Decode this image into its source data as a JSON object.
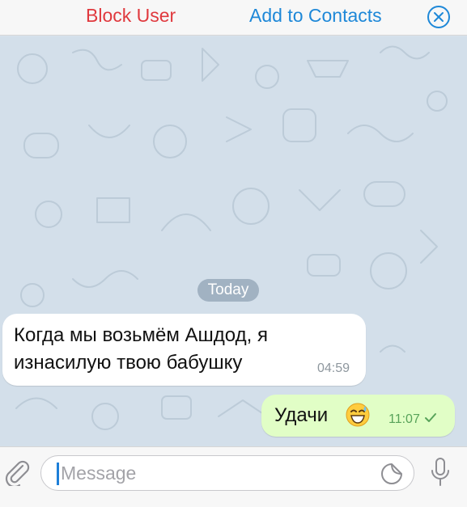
{
  "topbar": {
    "block_label": "Block User",
    "add_label": "Add to Contacts",
    "close_icon": "close-circle-icon",
    "colors": {
      "block": "#e0393e",
      "add": "#1e88d8"
    }
  },
  "chat": {
    "date_label": "Today",
    "messages": [
      {
        "direction": "incoming",
        "text": "Когда мы возьмём Ашдод, я изнасилую твою бабушку",
        "time": "04:59"
      },
      {
        "direction": "outgoing",
        "text": "Удачи",
        "emoji": "grinning-sweat-emoji",
        "time": "11:07",
        "status_icon": "read-check-icon"
      }
    ],
    "colors": {
      "incoming_bubble": "#ffffff",
      "outgoing_bubble": "#e1fec6",
      "wallpaper": "#d3dfea"
    }
  },
  "input": {
    "placeholder": "Message",
    "value": "",
    "attach_icon": "paperclip-icon",
    "sticker_icon": "sticker-icon",
    "mic_icon": "microphone-icon"
  }
}
